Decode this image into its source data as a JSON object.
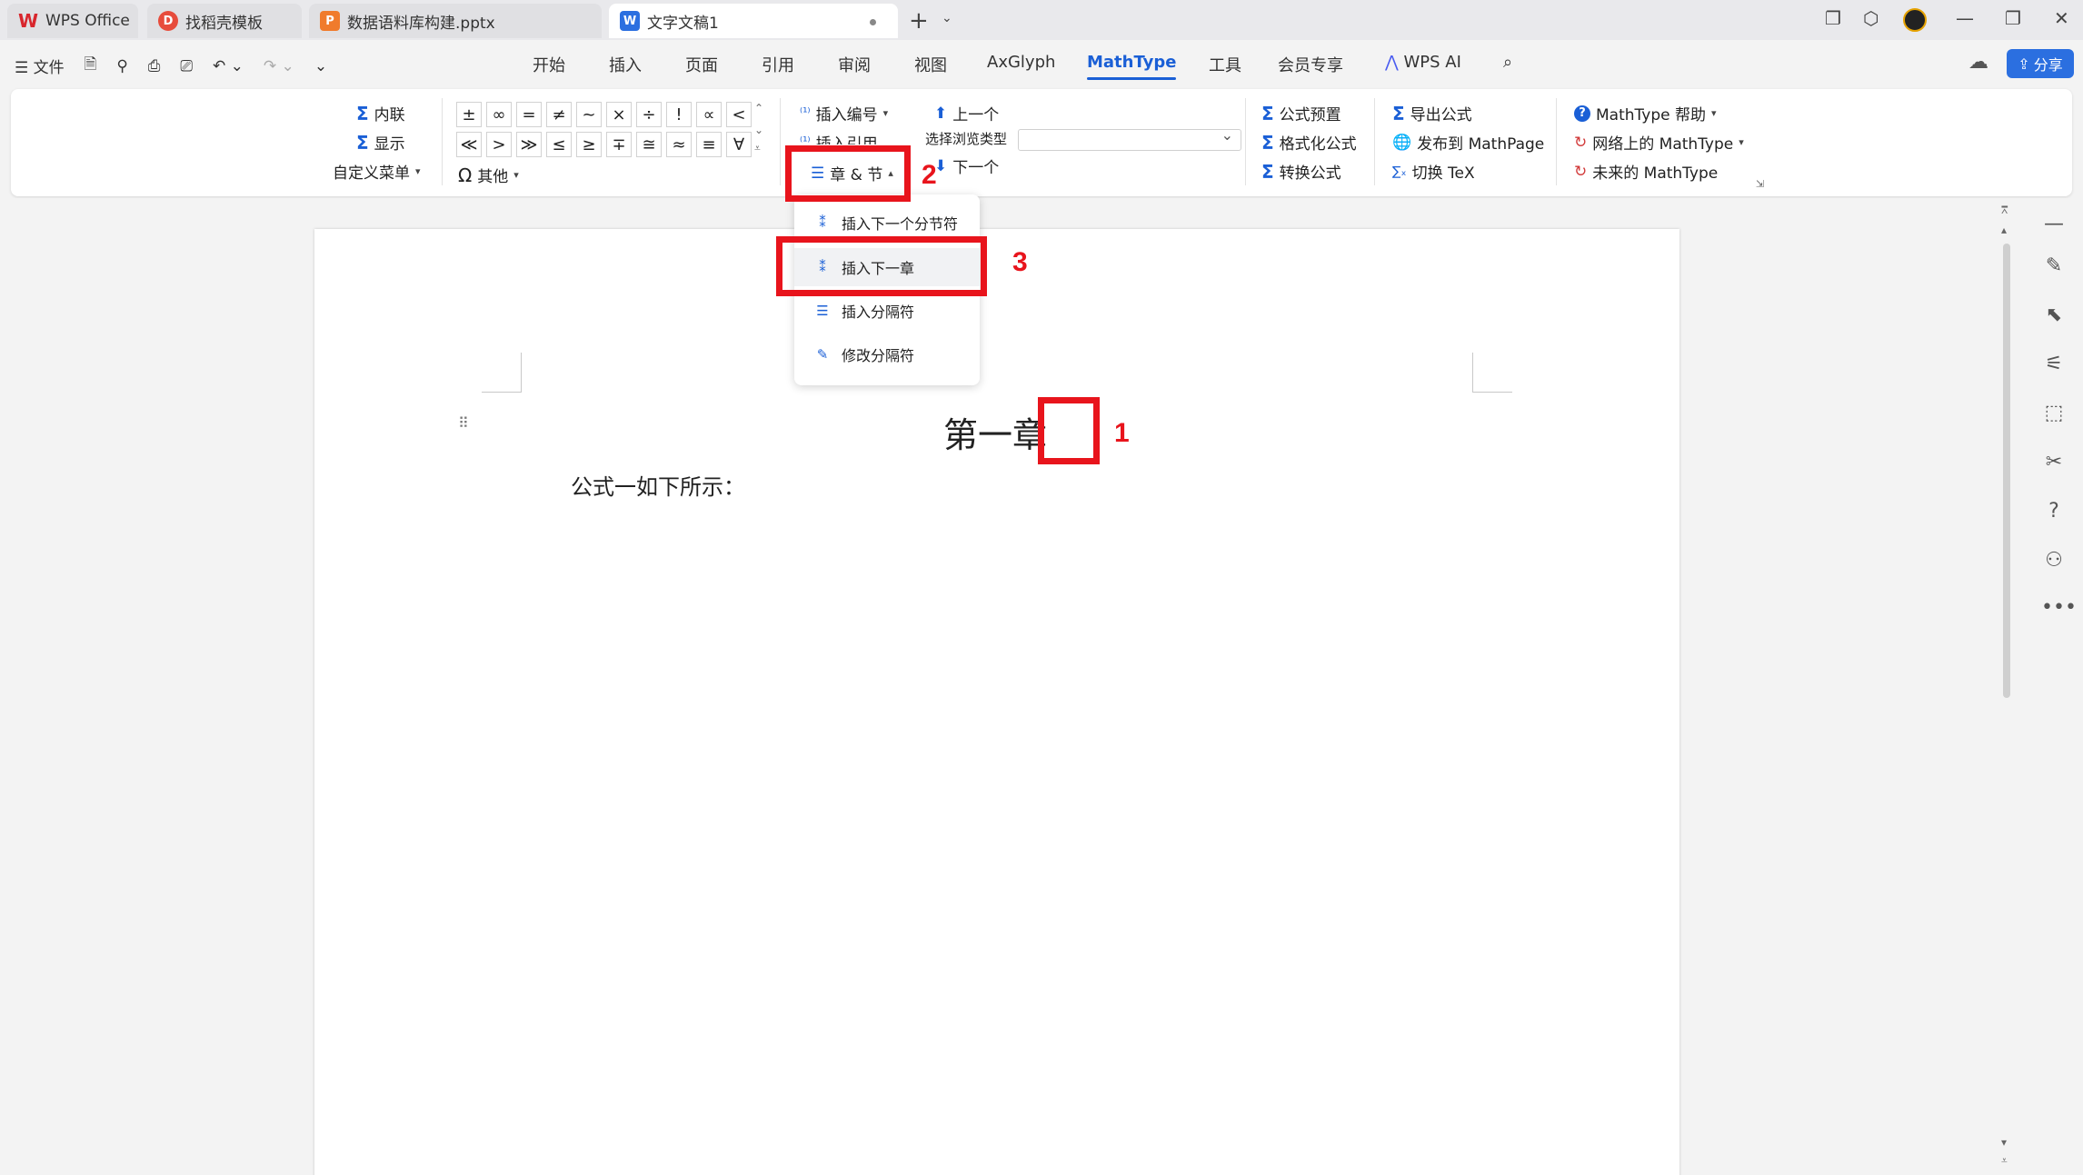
{
  "titlebar": {
    "tabs": [
      {
        "label": "WPS Office",
        "icon": "wps-logo-icon"
      },
      {
        "label": "找稻壳模板",
        "icon": "docer-icon"
      },
      {
        "label": "数据语料库构建.pptx",
        "icon": "ppt-icon"
      },
      {
        "label": "文字文稿1",
        "icon": "word-icon",
        "active": true
      }
    ]
  },
  "menubar": {
    "file_label": "文件",
    "tabs": [
      "开始",
      "插入",
      "页面",
      "引用",
      "审阅",
      "视图",
      "AxGlyph",
      "MathType",
      "工具",
      "会员专享",
      "WPS AI"
    ],
    "active_tab": "MathType",
    "share_label": "分享"
  },
  "ribbon": {
    "inline_label": "内联",
    "display_label": "显示",
    "custom_menu_label": "自定义菜单",
    "symbols_row1": [
      "±",
      "∞",
      "=",
      "≠",
      "~",
      "×",
      "÷",
      "!",
      "∝",
      "<"
    ],
    "symbols_row2": [
      "≪",
      ">",
      "≫",
      "≤",
      "≥",
      "∓",
      "≅",
      "≈",
      "≡",
      "∀"
    ],
    "other_label": "其他",
    "insert_number_label": "插入编号",
    "insert_ref_label": "插入引用",
    "chapter_section_label": "章 & 节",
    "prev_label": "上一个",
    "browse_type_label": "选择浏览类型",
    "next_label": "下一个",
    "formula_preset_label": "公式预置",
    "format_formula_label": "格式化公式",
    "convert_formula_label": "转换公式",
    "export_formula_label": "导出公式",
    "publish_mathpage_label": "发布到 MathPage",
    "toggle_tex_label": "切换 TeX",
    "mathtype_help_label": "MathType 帮助",
    "mathtype_online_label": "网络上的 MathType",
    "mathtype_future_label": "未来的 MathType"
  },
  "dropdown": {
    "items": [
      {
        "label": "插入下一个分节符",
        "icon": "section-break-icon"
      },
      {
        "label": "插入下一章",
        "icon": "next-chapter-icon"
      },
      {
        "label": "插入分隔符",
        "icon": "insert-separator-icon"
      },
      {
        "label": "修改分隔符",
        "icon": "edit-separator-icon"
      }
    ]
  },
  "document": {
    "heading": "第一章",
    "body": "公式一如下所示："
  },
  "annotations": {
    "labels": [
      "1",
      "2",
      "3"
    ],
    "color": "#e8141c"
  },
  "colors": {
    "accent": "#1a5fd6",
    "annotation": "#e8141c"
  }
}
